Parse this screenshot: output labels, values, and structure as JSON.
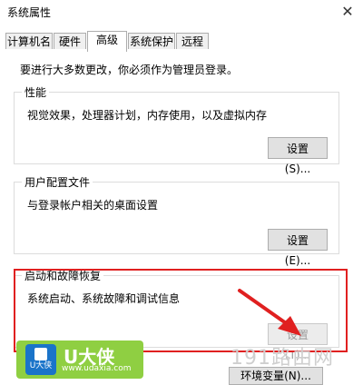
{
  "window": {
    "title": "系统属性",
    "close_glyph": "✕"
  },
  "tabs": [
    {
      "label": "计算机名"
    },
    {
      "label": "硬件"
    },
    {
      "label": "高级",
      "active": true
    },
    {
      "label": "系统保护"
    },
    {
      "label": "远程"
    }
  ],
  "notice": "要进行大多数更改，你必须作为管理员登录。",
  "performance": {
    "title": "性能",
    "desc": "视觉效果，处理器计划，内存使用，以及虚拟内存",
    "button": "设置(S)..."
  },
  "profiles": {
    "title": "用户配置文件",
    "desc": "与登录帐户相关的桌面设置",
    "button": "设置(E)..."
  },
  "startup": {
    "title": "启动和故障恢复",
    "desc": "系统启动、系统故障和调试信息",
    "button": "设置(T)..."
  },
  "env_button": "环境变量(N)...",
  "watermarks": {
    "brand": "U大侠",
    "url": "www.udaxia.com",
    "icon_label": "U大侠",
    "site": "191路由网"
  },
  "colors": {
    "highlight": "#e02020",
    "logo_bg": "#8fcf42",
    "logo_icon_bg": "#1a74c9"
  }
}
